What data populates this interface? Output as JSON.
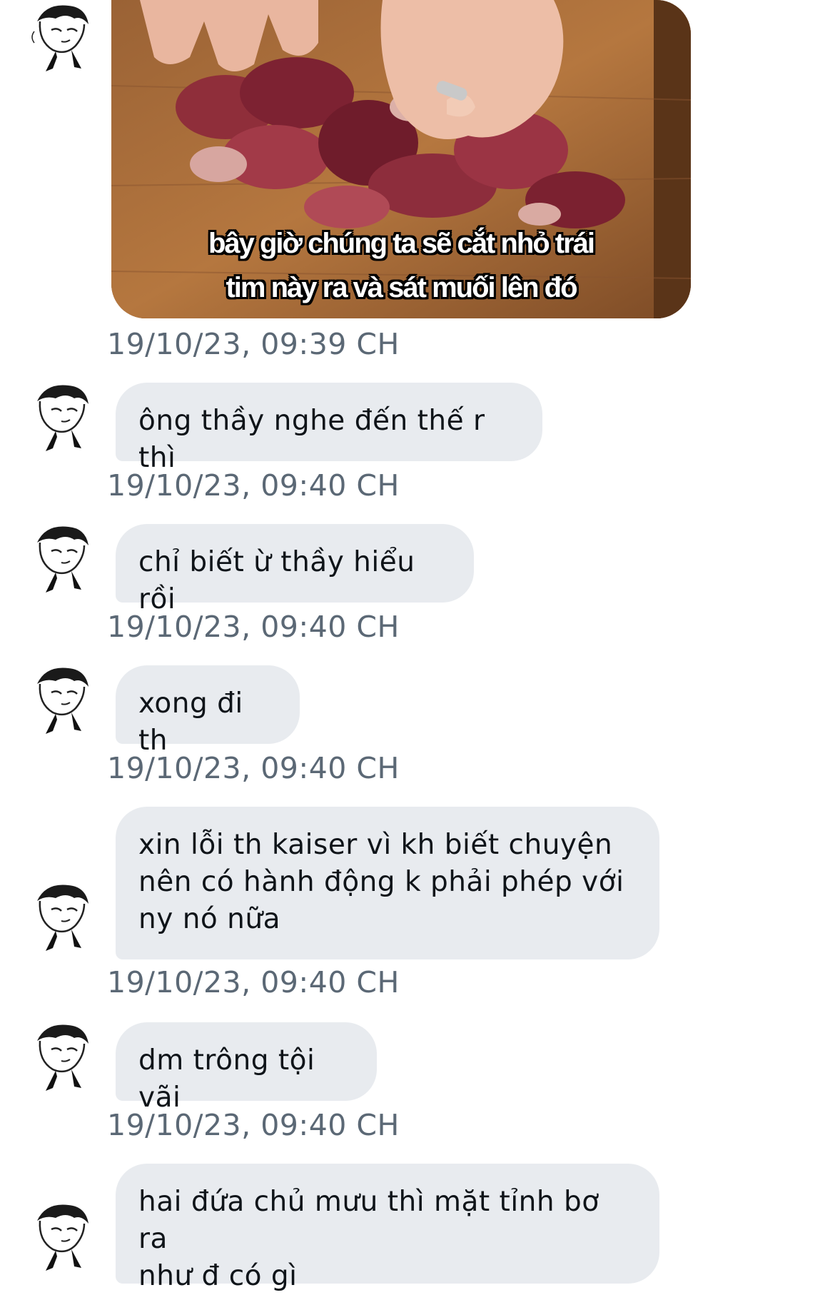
{
  "image_message": {
    "caption_line1": "bây giờ chúng ta sẽ cắt nhỏ trái",
    "caption_line2": "tim này ra và sát muối lên đó",
    "timestamp": "19/10/23, 09:39 CH"
  },
  "messages": [
    {
      "text": "ông thầy nghe đến thế r thì",
      "timestamp": "19/10/23, 09:40 CH"
    },
    {
      "text": "chỉ biết ừ thầy hiểu rồi",
      "timestamp": "19/10/23, 09:40 CH"
    },
    {
      "text": "xong đi th",
      "timestamp": "19/10/23, 09:40 CH"
    },
    {
      "text": "xin lỗi th kaiser vì kh biết chuyện\nnên có hành động k phải phép với\nny nó nữa",
      "timestamp": "19/10/23, 09:40 CH"
    },
    {
      "text": "dm trông tội vãi",
      "timestamp": "19/10/23, 09:40 CH"
    },
    {
      "text": "hai đứa chủ mưu thì mặt tỉnh bơ ra\nnhư đ có gì",
      "timestamp": ""
    }
  ],
  "colors": {
    "bubble_bg": "#e8ebef",
    "message_text": "#0f1419",
    "timestamp_text": "#5b6875"
  },
  "icons": [
    "avatar-manga-character-icon"
  ]
}
